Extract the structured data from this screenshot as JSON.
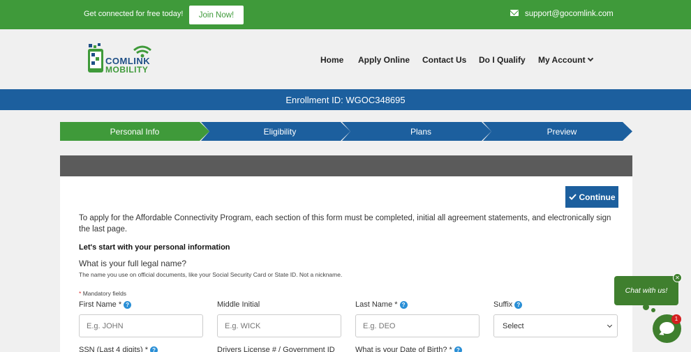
{
  "topbar": {
    "promo": "Get connected for free today!",
    "join_label": "Join Now!",
    "email": "support@gocomlink.com"
  },
  "brand": {
    "line1": "COMLINK",
    "line2": "MOBILITY"
  },
  "nav": {
    "home": "Home",
    "apply": "Apply Online",
    "contact": "Contact Us",
    "qualify": "Do I Qualify",
    "account": "My Account"
  },
  "enrollment": "Enrollment ID: WGOC348695",
  "steps": [
    "Personal Info",
    "Eligibility",
    "Plans",
    "Preview"
  ],
  "form": {
    "continue_label": "Continue",
    "intro": "To apply for the Affordable Connectivity Program, each section of this form must be completed, initial all agreement statements, and electronically sign the last page.",
    "section_title": "Let's start with your personal information",
    "name_question": "What is your full legal name?",
    "name_note": "The name you use on official documents, like your Social Security Card or State ID. Not a nickname.",
    "mandatory": "Mandatory fields",
    "first_name": {
      "label": "First Name *",
      "placeholder": "E.g. JOHN"
    },
    "middle_initial": {
      "label": "Middle Initial",
      "placeholder": "E.g. WICK"
    },
    "last_name": {
      "label": "Last Name *",
      "placeholder": "E.g. DEO"
    },
    "suffix": {
      "label": "Suffix",
      "value": "Select"
    },
    "ssn_label": "SSN (Last 4 digits) *",
    "license_label": "Drivers License # / Government ID",
    "dob_label": "What is your Date of Birth? *"
  },
  "chat": {
    "label": "Chat with us!",
    "badge": "1"
  },
  "colors": {
    "green": "#3f9a3a",
    "blue": "#1c5f9e",
    "dark_header": "#5b5b5b"
  }
}
